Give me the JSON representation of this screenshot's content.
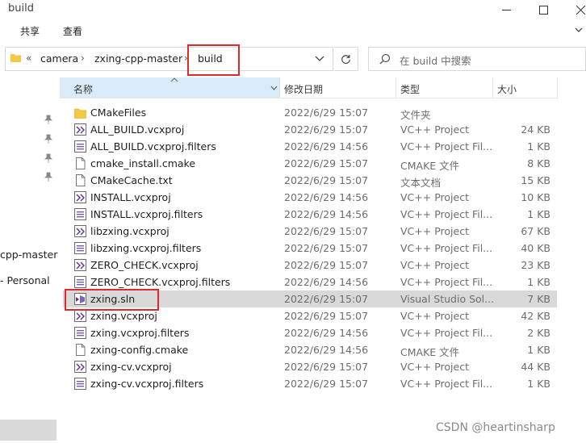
{
  "window": {
    "title": "build"
  },
  "ribbon": {
    "tabs": [
      "共享",
      "查看"
    ]
  },
  "address": {
    "overflow": "«",
    "crumbs": [
      "camera",
      "zxing-cpp-master",
      "build"
    ]
  },
  "search": {
    "placeholder": "在 build 中搜索"
  },
  "nav": {
    "labels": [
      "cpp-master",
      "- Personal"
    ]
  },
  "columns": {
    "name": "名称",
    "date": "修改日期",
    "type": "类型",
    "size": "大小"
  },
  "files": [
    {
      "name": "CMakeFiles",
      "date": "2022/6/29 15:07",
      "type": "文件夹",
      "size": "",
      "icon": "folder-icon"
    },
    {
      "name": "ALL_BUILD.vcxproj",
      "date": "2022/6/29 15:07",
      "type": "VC++ Project",
      "size": "24 KB",
      "icon": "vcxproj-icon"
    },
    {
      "name": "ALL_BUILD.vcxproj.filters",
      "date": "2022/6/29 14:56",
      "type": "VC++ Project Fil...",
      "size": "1 KB",
      "icon": "filters-icon"
    },
    {
      "name": "cmake_install.cmake",
      "date": "2022/6/29 15:07",
      "type": "CMAKE 文件",
      "size": "8 KB",
      "icon": "document-icon"
    },
    {
      "name": "CMakeCache.txt",
      "date": "2022/6/29 15:07",
      "type": "文本文档",
      "size": "15 KB",
      "icon": "document-icon"
    },
    {
      "name": "INSTALL.vcxproj",
      "date": "2022/6/29 14:56",
      "type": "VC++ Project",
      "size": "10 KB",
      "icon": "vcxproj-icon"
    },
    {
      "name": "INSTALL.vcxproj.filters",
      "date": "2022/6/29 14:56",
      "type": "VC++ Project Fil...",
      "size": "1 KB",
      "icon": "filters-icon"
    },
    {
      "name": "libzxing.vcxproj",
      "date": "2022/6/29 15:07",
      "type": "VC++ Project",
      "size": "67 KB",
      "icon": "vcxproj-icon"
    },
    {
      "name": "libzxing.vcxproj.filters",
      "date": "2022/6/29 15:07",
      "type": "VC++ Project Fil...",
      "size": "40 KB",
      "icon": "filters-icon"
    },
    {
      "name": "ZERO_CHECK.vcxproj",
      "date": "2022/6/29 15:07",
      "type": "VC++ Project",
      "size": "23 KB",
      "icon": "vcxproj-icon"
    },
    {
      "name": "ZERO_CHECK.vcxproj.filters",
      "date": "2022/6/29 14:56",
      "type": "VC++ Project Fil...",
      "size": "1 KB",
      "icon": "filters-icon"
    },
    {
      "name": "zxing.sln",
      "date": "2022/6/29 15:07",
      "type": "Visual Studio Sol...",
      "size": "7 KB",
      "icon": "solution-icon"
    },
    {
      "name": "zxing.vcxproj",
      "date": "2022/6/29 15:07",
      "type": "VC++ Project",
      "size": "42 KB",
      "icon": "vcxproj-icon"
    },
    {
      "name": "zxing.vcxproj.filters",
      "date": "2022/6/29 14:56",
      "type": "VC++ Project Fil...",
      "size": "2 KB",
      "icon": "filters-icon"
    },
    {
      "name": "zxing-config.cmake",
      "date": "2022/6/29 14:56",
      "type": "CMAKE 文件",
      "size": "1 KB",
      "icon": "document-icon"
    },
    {
      "name": "zxing-cv.vcxproj",
      "date": "2022/6/29 15:07",
      "type": "VC++ Project",
      "size": "44 KB",
      "icon": "vcxproj-icon"
    },
    {
      "name": "zxing-cv.vcxproj.filters",
      "date": "2022/6/29 15:07",
      "type": "VC++ Project Fil...",
      "size": "1 KB",
      "icon": "filters-icon"
    }
  ],
  "selected_file": "zxing.sln",
  "watermark": "CSDN @heartinsharp",
  "colors": {
    "highlight": "#e0292a",
    "selection": "#d9d9d9",
    "header_active": "#d9ebf9",
    "folder": "#f5c842"
  }
}
